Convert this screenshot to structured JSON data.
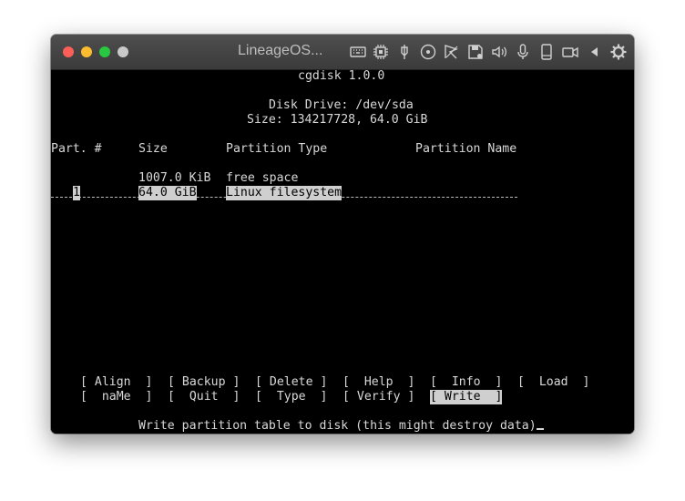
{
  "window": {
    "title": "LineageOS...",
    "titlebar_icons": [
      "keyboard-icon",
      "cpu-icon",
      "usb-icon",
      "cd-icon",
      "network-icon",
      "save-icon",
      "volume-icon",
      "microphone-icon",
      "phone-icon",
      "camera-icon",
      "back-icon",
      "settings-icon"
    ]
  },
  "terminal": {
    "app_title": "cgdisk 1.0.0",
    "disk_drive": "Disk Drive: /dev/sda",
    "size_line": "Size: 134217728, 64.0 GiB",
    "headers": {
      "part": "Part. #",
      "size": "Size",
      "type": "Partition Type",
      "name": "Partition Name"
    },
    "rows": [
      {
        "part": "",
        "size": "1007.0 KiB",
        "type": "free space",
        "name": ""
      },
      {
        "part": "1",
        "size": "64.0 GiB",
        "type": "Linux filesystem",
        "name": ""
      }
    ],
    "menu": [
      [
        "[ Align  ]",
        "[ Backup ]",
        "[ Delete ]",
        "[  Help  ]",
        "[  Info  ]",
        "[  Load  ]"
      ],
      [
        "[  naMe  ]",
        "[  Quit  ]",
        "[  Type  ]",
        "[ Verify ]",
        "[ Write  ]"
      ]
    ],
    "selected_menu": "[ Write  ]",
    "status": "Write partition table to disk (this might destroy data)"
  },
  "colors": {
    "background": "#000000",
    "foreground": "#d8d8d8",
    "highlight": "#cfcfcf",
    "titlebar": "#454545"
  }
}
